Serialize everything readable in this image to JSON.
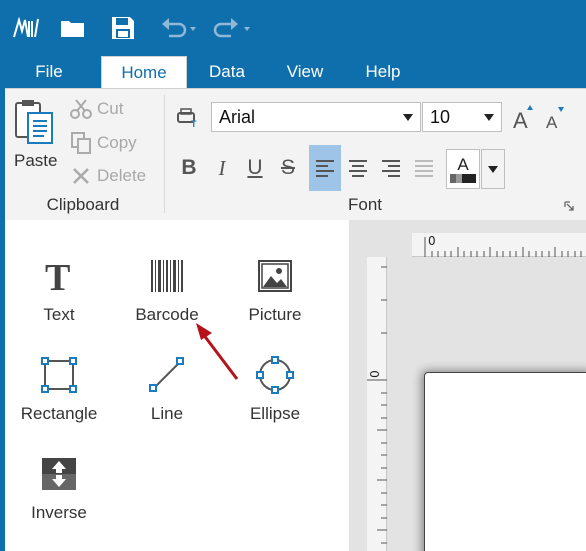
{
  "titlebar": {
    "icons": [
      "app-logo-icon",
      "folder-open-icon",
      "save-icon",
      "undo-icon",
      "redo-icon"
    ]
  },
  "tabs": [
    {
      "label": "File",
      "active": false
    },
    {
      "label": "Home",
      "active": true
    },
    {
      "label": "Data",
      "active": false
    },
    {
      "label": "View",
      "active": false
    },
    {
      "label": "Help",
      "active": false
    }
  ],
  "clipboard": {
    "paste": "Paste",
    "cut": "Cut",
    "copy": "Copy",
    "delete": "Delete",
    "group_label": "Clipboard"
  },
  "font": {
    "family": "Arial",
    "size": "10",
    "bold": "B",
    "italic": "I",
    "underline": "U",
    "strike": "S",
    "color_letter": "A",
    "group_label": "Font",
    "active_alignment": "align-left"
  },
  "tools": [
    {
      "label": "Text",
      "icon": "text-tool-icon"
    },
    {
      "label": "Barcode",
      "icon": "barcode-icon"
    },
    {
      "label": "Picture",
      "icon": "picture-icon"
    },
    {
      "label": "Rectangle",
      "icon": "rectangle-icon"
    },
    {
      "label": "Line",
      "icon": "line-icon"
    },
    {
      "label": "Ellipse",
      "icon": "ellipse-icon"
    },
    {
      "label": "Inverse",
      "icon": "inverse-icon"
    }
  ],
  "rulers": {
    "top_origin": "0",
    "left_origin": "0"
  },
  "colors": {
    "titlebar": "#0f6fad",
    "ribbon": "#f3f3f3",
    "active_format": "#9ec5e8",
    "annotation_arrow": "#b5121b"
  }
}
